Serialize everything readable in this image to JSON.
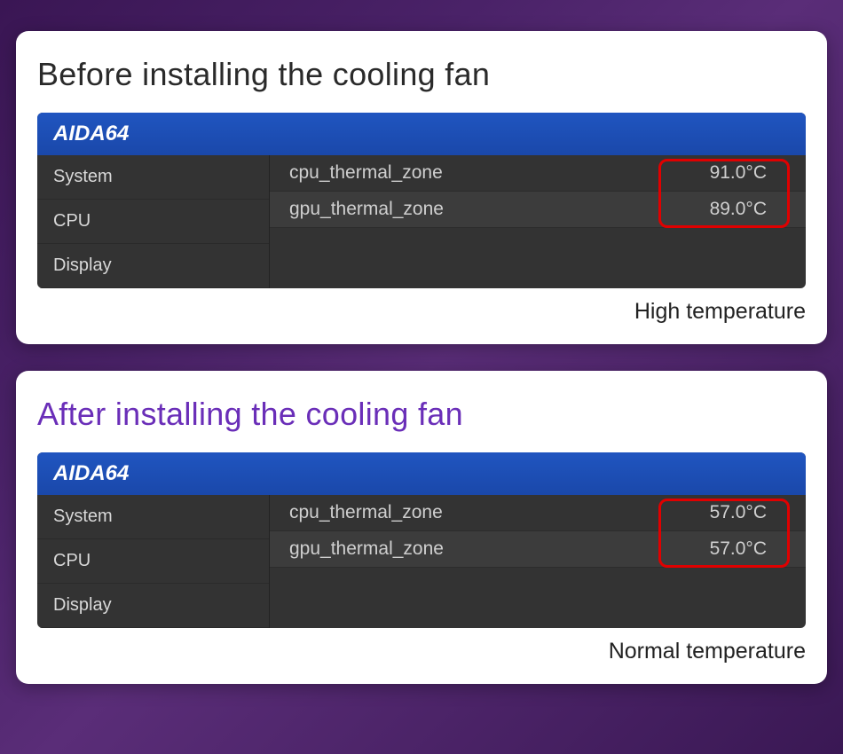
{
  "cards": {
    "before": {
      "title": "Before installing the cooling fan",
      "caption": "High temperature",
      "header": "AIDA64",
      "sidebar": {
        "item0": "System",
        "item1": "CPU",
        "item2": "Display"
      },
      "rows": {
        "r0": {
          "label": "cpu_thermal_zone",
          "value": "91.0°C"
        },
        "r1": {
          "label": "gpu_thermal_zone",
          "value": "89.0°C"
        }
      }
    },
    "after": {
      "title": "After installing the cooling fan",
      "caption": "Normal temperature",
      "header": "AIDA64",
      "sidebar": {
        "item0": "System",
        "item1": "CPU",
        "item2": "Display"
      },
      "rows": {
        "r0": {
          "label": "cpu_thermal_zone",
          "value": "57.0°C"
        },
        "r1": {
          "label": "gpu_thermal_zone",
          "value": "57.0°C"
        }
      }
    }
  }
}
